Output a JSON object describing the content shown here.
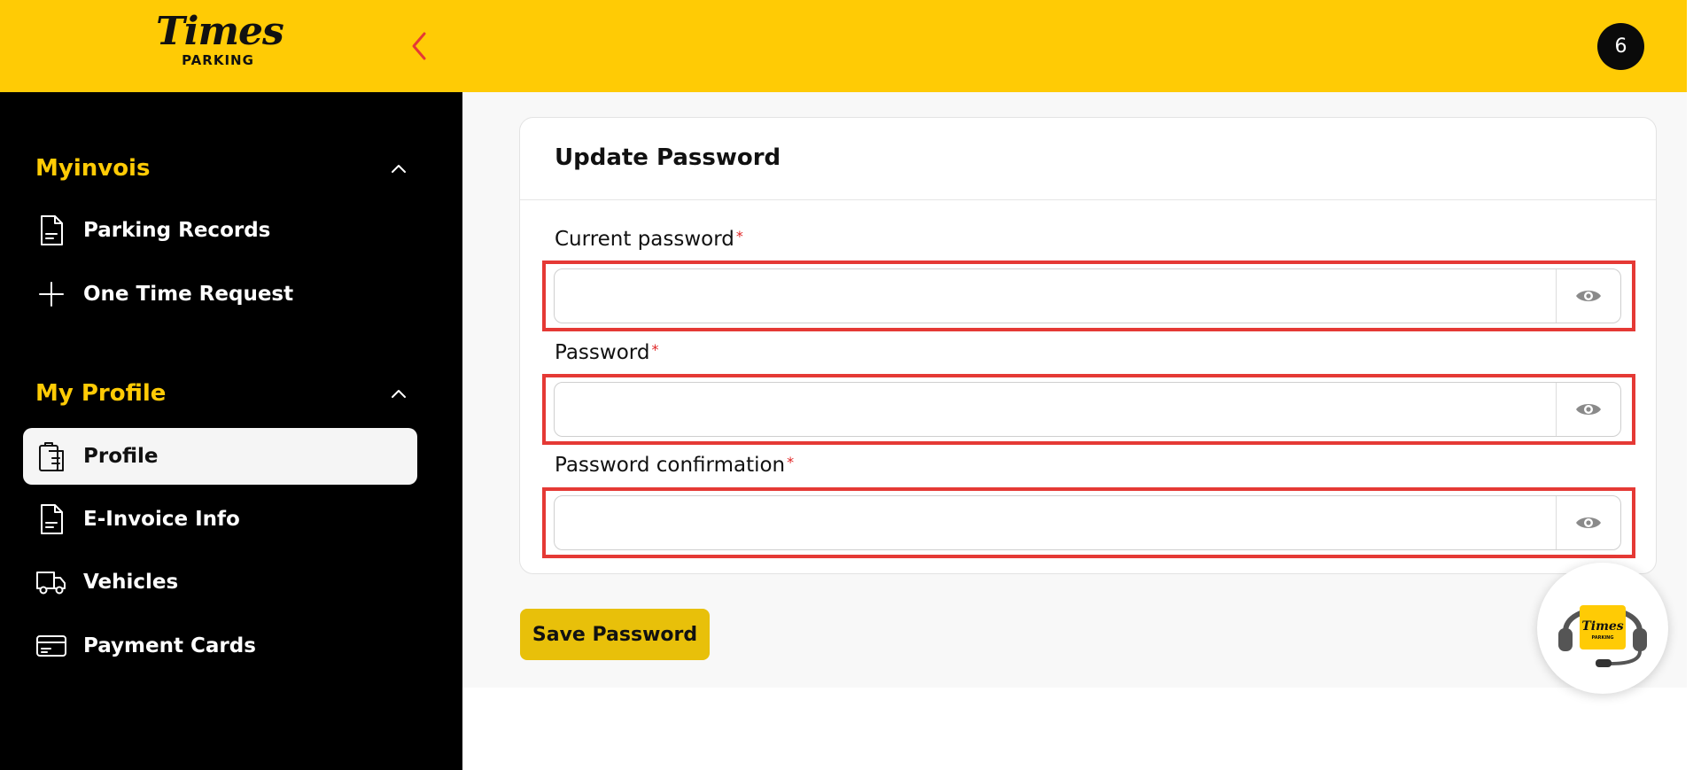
{
  "header": {
    "logo_title": "Times",
    "logo_subtitle": "PARKING",
    "avatar_text": "6",
    "brand_color": "#ffcb05",
    "collapse_icon": "chevron-left-icon"
  },
  "sidebar": {
    "sections": [
      {
        "title": "Myinvois",
        "expanded": true,
        "items": [
          {
            "label": "Parking Records",
            "icon": "document-icon"
          },
          {
            "label": "One Time Request",
            "icon": "plus-icon"
          }
        ]
      },
      {
        "title": "My Profile",
        "expanded": true,
        "items": [
          {
            "label": "Profile",
            "icon": "clipboard-icon",
            "active": true
          },
          {
            "label": "E-Invoice Info",
            "icon": "document-icon"
          },
          {
            "label": "Vehicles",
            "icon": "truck-icon"
          },
          {
            "label": "Payment Cards",
            "icon": "credit-card-icon"
          }
        ]
      }
    ]
  },
  "main": {
    "card_title": "Update Password",
    "fields": [
      {
        "label": "Current password",
        "required": "*",
        "value": ""
      },
      {
        "label": "Password",
        "required": "*",
        "value": ""
      },
      {
        "label": "Password confirmation",
        "required": "*",
        "value": ""
      }
    ],
    "save_button": "Save Password",
    "support_widget_logo_title": "Times",
    "support_widget_logo_subtitle": "PARKING"
  }
}
